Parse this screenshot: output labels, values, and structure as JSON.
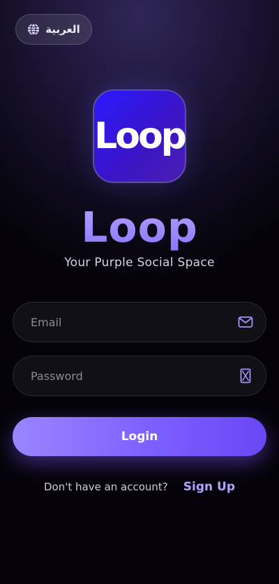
{
  "language_toggle": {
    "label": "العربية",
    "icon": "globe-icon"
  },
  "logo": {
    "text": "Loop"
  },
  "app": {
    "name": "Loop",
    "tagline": "Your Purple Social Space"
  },
  "form": {
    "email": {
      "placeholder": "Email",
      "value": "",
      "icon": "mail-icon"
    },
    "password": {
      "placeholder": "Password",
      "value": "",
      "icon": "password-toggle-icon"
    },
    "login_label": "Login"
  },
  "signup": {
    "prompt": "Don't have an account?",
    "link_label": "Sign Up"
  },
  "colors": {
    "accent": "#8b72ff",
    "background": "#0e0a1c",
    "field_bg": "#111015"
  }
}
